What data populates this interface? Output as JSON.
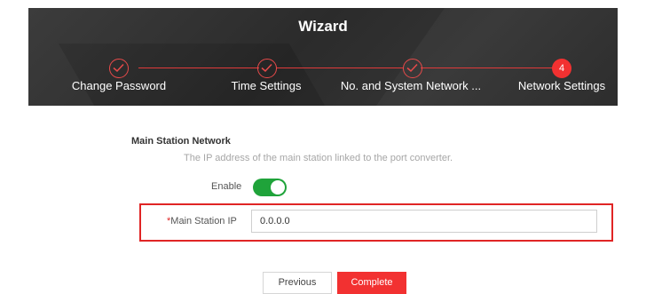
{
  "wizard": {
    "title": "Wizard",
    "steps": [
      {
        "label": "Change Password",
        "status": "done",
        "icon": "check-icon"
      },
      {
        "label": "Time Settings",
        "status": "done",
        "icon": "check-icon"
      },
      {
        "label": "No. and System Network ...",
        "status": "done",
        "icon": "check-icon"
      },
      {
        "label": "Network Settings",
        "status": "active",
        "number": "4"
      }
    ]
  },
  "section": {
    "title": "Main Station Network",
    "description": "The IP address of the main station linked to the port converter."
  },
  "form": {
    "enable_label": "Enable",
    "enable_on": true,
    "ip_required_mark": "*",
    "ip_label": "Main Station IP",
    "ip_value": "0.0.0.0"
  },
  "buttons": {
    "previous": "Previous",
    "complete": "Complete"
  },
  "colors": {
    "accent": "#f23131",
    "toggle_on": "#1fa33a",
    "header_bg": "#2f2f2f",
    "highlight": "#e02525"
  }
}
